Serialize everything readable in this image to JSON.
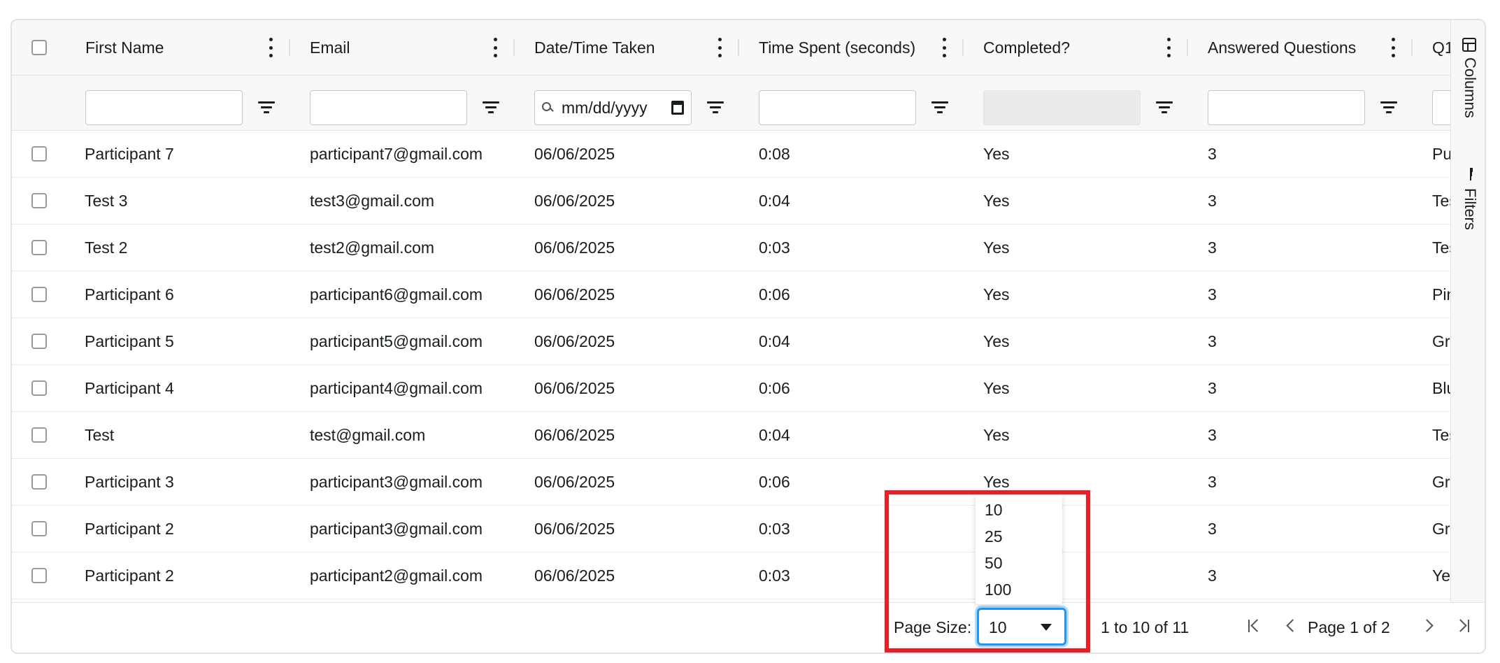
{
  "columns": [
    {
      "label": "First Name",
      "filter_placeholder": ""
    },
    {
      "label": "Email",
      "filter_placeholder": ""
    },
    {
      "label": "Date/Time Taken",
      "filter_placeholder": "mm/dd/yyyy"
    },
    {
      "label": "Time Spent (seconds)",
      "filter_placeholder": ""
    },
    {
      "label": "Completed?",
      "filter_placeholder": ""
    },
    {
      "label": "Answered Questions",
      "filter_placeholder": ""
    },
    {
      "label": "Q1"
    }
  ],
  "rows": [
    {
      "first_name": "Participant 7",
      "email": "participant7@gmail.com",
      "date": "06/06/2025",
      "time": "0:08",
      "completed": "Yes",
      "answered": "3",
      "q1": "Pu"
    },
    {
      "first_name": "Test 3",
      "email": "test3@gmail.com",
      "date": "06/06/2025",
      "time": "0:04",
      "completed": "Yes",
      "answered": "3",
      "q1": "Tes"
    },
    {
      "first_name": "Test 2",
      "email": "test2@gmail.com",
      "date": "06/06/2025",
      "time": "0:03",
      "completed": "Yes",
      "answered": "3",
      "q1": "Tes"
    },
    {
      "first_name": "Participant 6",
      "email": "participant6@gmail.com",
      "date": "06/06/2025",
      "time": "0:06",
      "completed": "Yes",
      "answered": "3",
      "q1": "Pin"
    },
    {
      "first_name": "Participant 5",
      "email": "participant5@gmail.com",
      "date": "06/06/2025",
      "time": "0:04",
      "completed": "Yes",
      "answered": "3",
      "q1": "Gre"
    },
    {
      "first_name": "Participant 4",
      "email": "participant4@gmail.com",
      "date": "06/06/2025",
      "time": "0:06",
      "completed": "Yes",
      "answered": "3",
      "q1": "Blu"
    },
    {
      "first_name": "Test",
      "email": "test@gmail.com",
      "date": "06/06/2025",
      "time": "0:04",
      "completed": "Yes",
      "answered": "3",
      "q1": "Tes"
    },
    {
      "first_name": "Participant 3",
      "email": "participant3@gmail.com",
      "date": "06/06/2025",
      "time": "0:06",
      "completed": "Yes",
      "answered": "3",
      "q1": "Gre"
    },
    {
      "first_name": "Participant 2",
      "email": "participant3@gmail.com",
      "date": "06/06/2025",
      "time": "0:03",
      "completed": "",
      "answered": "3",
      "q1": "Gre"
    },
    {
      "first_name": "Participant 2",
      "email": "participant2@gmail.com",
      "date": "06/06/2025",
      "time": "0:03",
      "completed": "",
      "answered": "3",
      "q1": "Yel"
    }
  ],
  "sidebar": {
    "columns_label": "Columns",
    "filters_label": "Filters"
  },
  "footer": {
    "page_size_label": "Page Size:",
    "page_size_value": "10",
    "row_count": "1 to 10 of 11",
    "page_info": "Page 1 of 2"
  },
  "page_size_options": [
    "10",
    "25",
    "50",
    "100"
  ],
  "colors": {
    "accent": "#2196f3",
    "highlight": "#ee1c25",
    "header_bg": "#f8f8f8",
    "border": "#dde2eb"
  },
  "icons": {
    "column_menu": "vertical-dots-icon",
    "filter": "filter-icon",
    "columns": "table-columns-icon",
    "filters": "filter-bars-icon"
  }
}
